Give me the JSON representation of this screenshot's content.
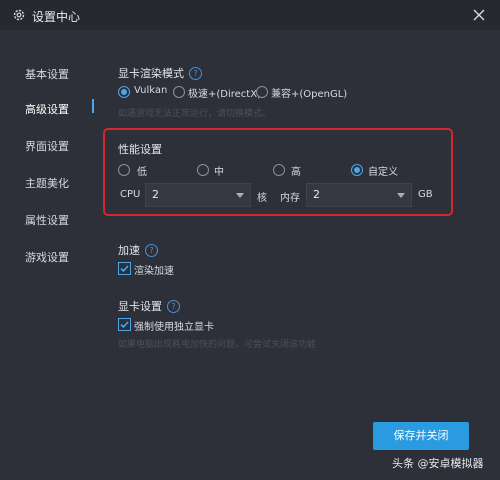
{
  "window": {
    "title": "设置中心"
  },
  "sidebar": {
    "items": [
      {
        "label": "基本设置"
      },
      {
        "label": "高级设置"
      },
      {
        "label": "界面设置"
      },
      {
        "label": "主题美化"
      },
      {
        "label": "属性设置"
      },
      {
        "label": "游戏设置"
      }
    ],
    "active": "高级设置"
  },
  "render_mode": {
    "title": "显卡渲染模式",
    "options": [
      {
        "label": "Vulkan",
        "selected": true
      },
      {
        "label": "极速+(DirectX)",
        "selected": false
      },
      {
        "label": "兼容+(OpenGL)",
        "selected": false
      }
    ],
    "hint": "如遇游戏无法正常运行，请切换模式。"
  },
  "performance": {
    "title": "性能设置",
    "options": [
      {
        "label": "低",
        "selected": false
      },
      {
        "label": "中",
        "selected": false
      },
      {
        "label": "高",
        "selected": false
      },
      {
        "label": "自定义",
        "selected": true
      }
    ],
    "cpu_label": "CPU",
    "cpu_value": "2",
    "cpu_unit": "核",
    "mem_label": "内存",
    "mem_value": "2",
    "mem_unit": "GB"
  },
  "acceleration": {
    "title": "加速",
    "checkbox_label": "渲染加速",
    "checked": true
  },
  "gpu": {
    "title": "显卡设置",
    "checkbox_label": "强制使用独立显卡",
    "checked": true,
    "hint": "如果电脑出现耗电加快的问题，可尝试关闭该功能"
  },
  "footer": {
    "save_label": "保存并关闭",
    "watermark": "头条 @安卓模拟器"
  },
  "colors": {
    "accent": "#2a9be0",
    "highlight_box": "#d8262b",
    "background": "#2d3038"
  }
}
